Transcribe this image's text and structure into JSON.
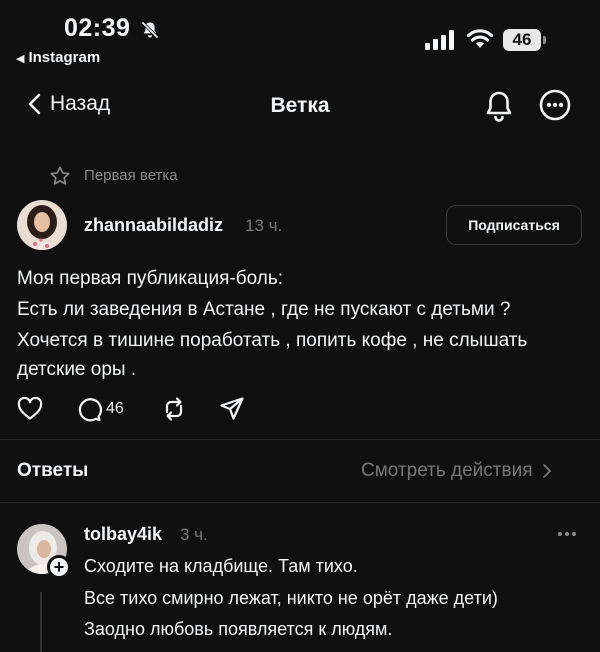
{
  "status_bar": {
    "time": "02:39",
    "back_app": "Instagram",
    "battery": "46"
  },
  "nav": {
    "back_label": "Назад",
    "title": "Ветка"
  },
  "thread_label": "Первая ветка",
  "post": {
    "username": "zhannaabildadiz",
    "time": "13 ч.",
    "follow_label": "Подписаться",
    "lines": [
      "Моя первая публикация-боль:",
      "Есть ли заведения в Астане , где не пускают с детьми ?",
      "Хочется в тишине поработать , попить кофе , не слышать",
      "детские оры ."
    ],
    "reply_count": "46"
  },
  "answers": {
    "label": "Ответы",
    "view_activity": "Смотреть действия"
  },
  "reply": {
    "username": "tolbay4ik",
    "time": "3 ч.",
    "lines": [
      "Сходите на кладбище. Там тихо.",
      "Все тихо смирно лежат, никто не орёт даже дети)",
      "Заодно любовь появляется к людям."
    ]
  }
}
